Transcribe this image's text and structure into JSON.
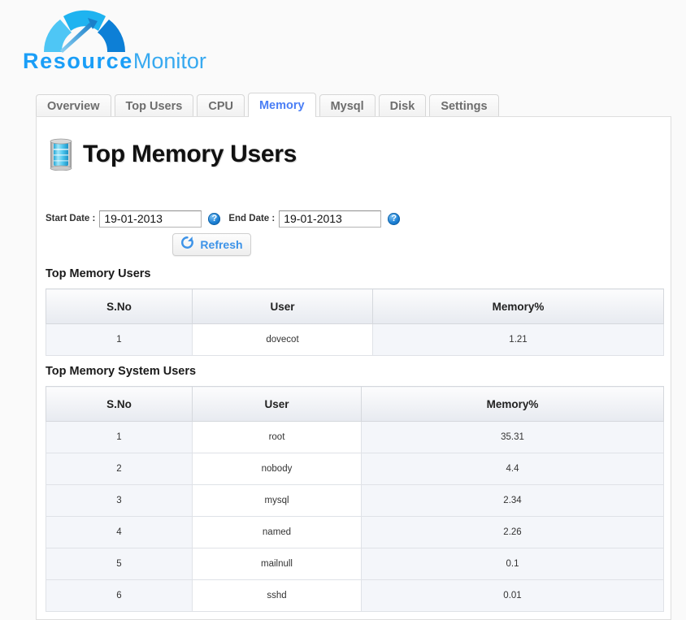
{
  "brand": {
    "name_strong": "Resource",
    "name_light": "Monitor",
    "gauge_colors": [
      "#4ec6f5",
      "#1fb3f0",
      "#0d7fd6"
    ]
  },
  "tabs": [
    {
      "label": "Overview",
      "active": false
    },
    {
      "label": "Top Users",
      "active": false
    },
    {
      "label": "CPU",
      "active": false
    },
    {
      "label": "Memory",
      "active": true
    },
    {
      "label": "Mysql",
      "active": false
    },
    {
      "label": "Disk",
      "active": false
    },
    {
      "label": "Settings",
      "active": false
    }
  ],
  "page": {
    "title": "Top Memory Users",
    "icon": "memory-module-icon"
  },
  "filters": {
    "start_label": "Start Date :",
    "start_value": "19-01-2013",
    "start_placeholder": "dd-mm-yyyy",
    "end_label": "End Date :",
    "end_value": "19-01-2013",
    "end_placeholder": "dd-mm-yyyy",
    "help_glyph": "?",
    "refresh_label": "Refresh",
    "refresh_icon": "refresh-circular-arrow-icon"
  },
  "sections": [
    {
      "title": "Top Memory Users",
      "columns": [
        "S.No",
        "User",
        "Memory%"
      ],
      "rows": [
        [
          "1",
          "dovecot",
          "1.21"
        ]
      ]
    },
    {
      "title": "Top Memory System Users",
      "columns": [
        "S.No",
        "User",
        "Memory%"
      ],
      "rows": [
        [
          "1",
          "root",
          "35.31"
        ],
        [
          "2",
          "nobody",
          "4.4"
        ],
        [
          "3",
          "mysql",
          "2.34"
        ],
        [
          "4",
          "named",
          "2.26"
        ],
        [
          "5",
          "mailnull",
          "0.1"
        ],
        [
          "6",
          "sshd",
          "0.01"
        ]
      ]
    }
  ],
  "colors": {
    "accent_blue": "#3d93e8",
    "active_tab_text": "#4a7ef5",
    "page_bg": "#fafafa",
    "row_tint": "#f4f6fa"
  }
}
